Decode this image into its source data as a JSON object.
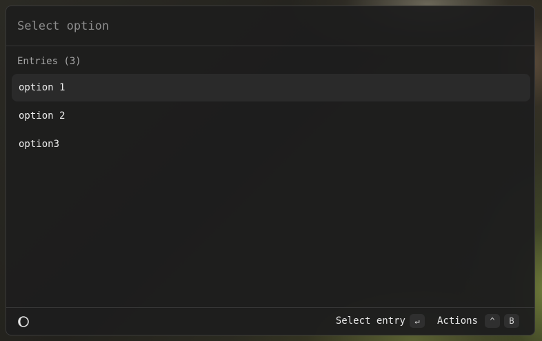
{
  "search": {
    "placeholder": "Select option"
  },
  "section": {
    "title": "Entries (3)"
  },
  "entries": [
    {
      "label": "option 1",
      "selected": true
    },
    {
      "label": "option 2",
      "selected": false
    },
    {
      "label": "option3",
      "selected": false
    }
  ],
  "footer": {
    "theme_icon": "moon-icon",
    "primary_action_label": "Select entry",
    "primary_action_key": "↵",
    "actions_label": "Actions",
    "actions_key_modifier": "^",
    "actions_key": "B"
  },
  "colors": {
    "panel_bg": "#1d1d1e",
    "selected_bg": "#2a2a2a",
    "text": "#ececec",
    "muted_text": "#a8a8a8"
  }
}
